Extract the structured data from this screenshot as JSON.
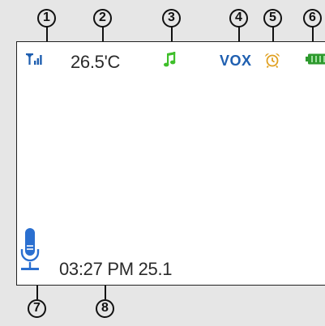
{
  "callouts": [
    "1",
    "2",
    "3",
    "4",
    "5",
    "6",
    "7",
    "8"
  ],
  "status_bar": {
    "signal_icon": "signal-strength-icon",
    "temperature": "26.5'C",
    "music_icon": "music-note-icon",
    "vox_label": "VOX",
    "alarm_icon": "alarm-clock-icon",
    "battery_icon": "battery-full-icon"
  },
  "footer": {
    "mic_icon": "microphone-icon",
    "clock_text": "03:27 PM 25.1"
  },
  "colors": {
    "signal": "#1f5fb0",
    "music": "#3fbf2a",
    "vox": "#1f5fb0",
    "alarm": "#e0a020",
    "battery": "#2e9a2e",
    "microphone": "#2a6fd0",
    "text": "#2a2a2a"
  }
}
